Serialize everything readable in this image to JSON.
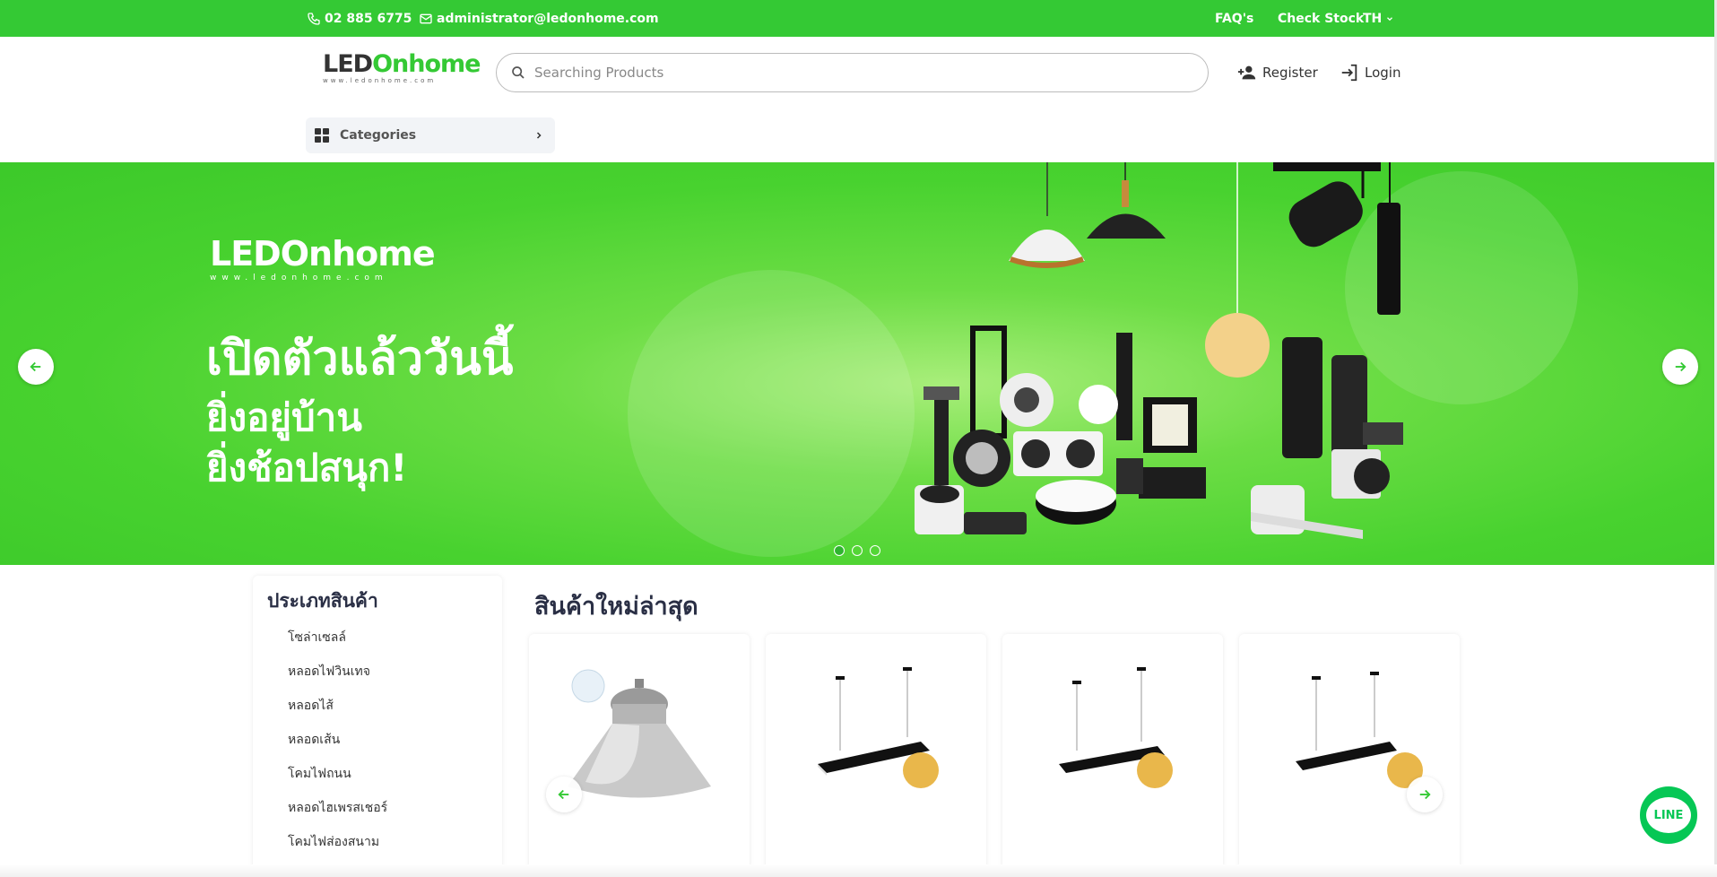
{
  "topbar": {
    "phone": "02 885 6775",
    "email": "administrator@ledonhome.com",
    "faq": "FAQ's",
    "check_stock": "Check Stock",
    "language": "TH"
  },
  "header": {
    "logo_led": "LED",
    "logo_on": "Onhome",
    "logo_url": "www.ledonhome.com",
    "search_placeholder": "Searching Products",
    "register": "Register",
    "login": "Login",
    "categories": "Categories"
  },
  "banner": {
    "logo_led": "LED",
    "logo_on": "Onhome",
    "logo_url": "www.ledonhome.com",
    "headline": "เปิดตัวแล้ววันนี้",
    "line2": "ยิ่งอยู่บ้าน",
    "line3": "ยิ่งช้อปสนุก!",
    "slide_count": 3,
    "active_slide": 1
  },
  "sidebar": {
    "title": "ประเภทสินค้า",
    "items": [
      "โซล่าเซลล์",
      "หลอดไฟวินเทจ",
      "หลอดไส้",
      "หลอดเส้น",
      "โคมไฟถนน",
      "หลอดไฮเพรสเชอร์",
      "โคมไฟส่องสนาม"
    ]
  },
  "products": {
    "title": "สินค้าใหม่ล่าสุด",
    "items": [
      {
        "type": "highbay-lamp"
      },
      {
        "type": "linear-pendant"
      },
      {
        "type": "linear-pendant"
      },
      {
        "type": "linear-pendant"
      }
    ]
  },
  "line_chat": "LINE",
  "colors": {
    "brand_green": "#34c934",
    "line_green": "#06c755",
    "heading": "#2a2f45"
  }
}
